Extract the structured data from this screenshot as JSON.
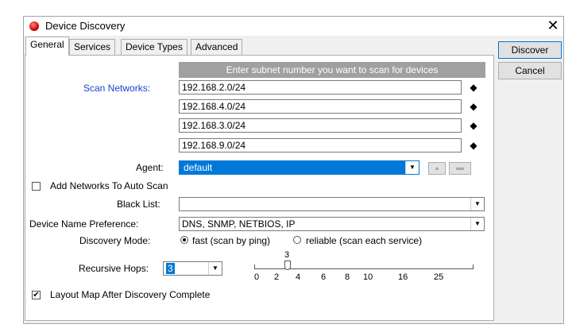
{
  "window": {
    "title": "Device Discovery",
    "close_glyph": "✕"
  },
  "tabs": [
    {
      "label": "General"
    },
    {
      "label": "Services"
    },
    {
      "label": "Device Types"
    },
    {
      "label": "Advanced"
    }
  ],
  "buttons": {
    "discover": "Discover",
    "cancel": "Cancel"
  },
  "scan": {
    "hint": "Enter subnet number you want to scan for devices",
    "label": "Scan Networks:",
    "networks": [
      "192.168.2.0/24",
      "192.168.4.0/24",
      "192.168.3.0/24",
      "192.168.9.0/24"
    ],
    "spin_glyph": "◆"
  },
  "agent": {
    "label": "Agent:",
    "value": "default",
    "btn_small": "▫",
    "btn_more": "▫▫▫"
  },
  "auto_scan": {
    "label": "Add Networks To Auto Scan",
    "checked": false
  },
  "black_list": {
    "label": "Black List:",
    "value": ""
  },
  "name_pref": {
    "label": "Device Name Preference:",
    "value": "DNS, SNMP, NETBIOS, IP"
  },
  "discovery_mode": {
    "label": "Discovery Mode:",
    "options": [
      "fast (scan by ping)",
      "reliable (scan each service)"
    ],
    "selected": 0
  },
  "hops": {
    "label": "Recursive Hops:",
    "value": "3",
    "slider_value": "3",
    "ticks": [
      "0",
      "2",
      "4",
      "6",
      "8",
      "10",
      "16",
      "25"
    ]
  },
  "layout_map": {
    "label": "Layout Map After Discovery Complete",
    "checked": true,
    "check_glyph": "✔"
  },
  "dropdown_glyph": "▼"
}
